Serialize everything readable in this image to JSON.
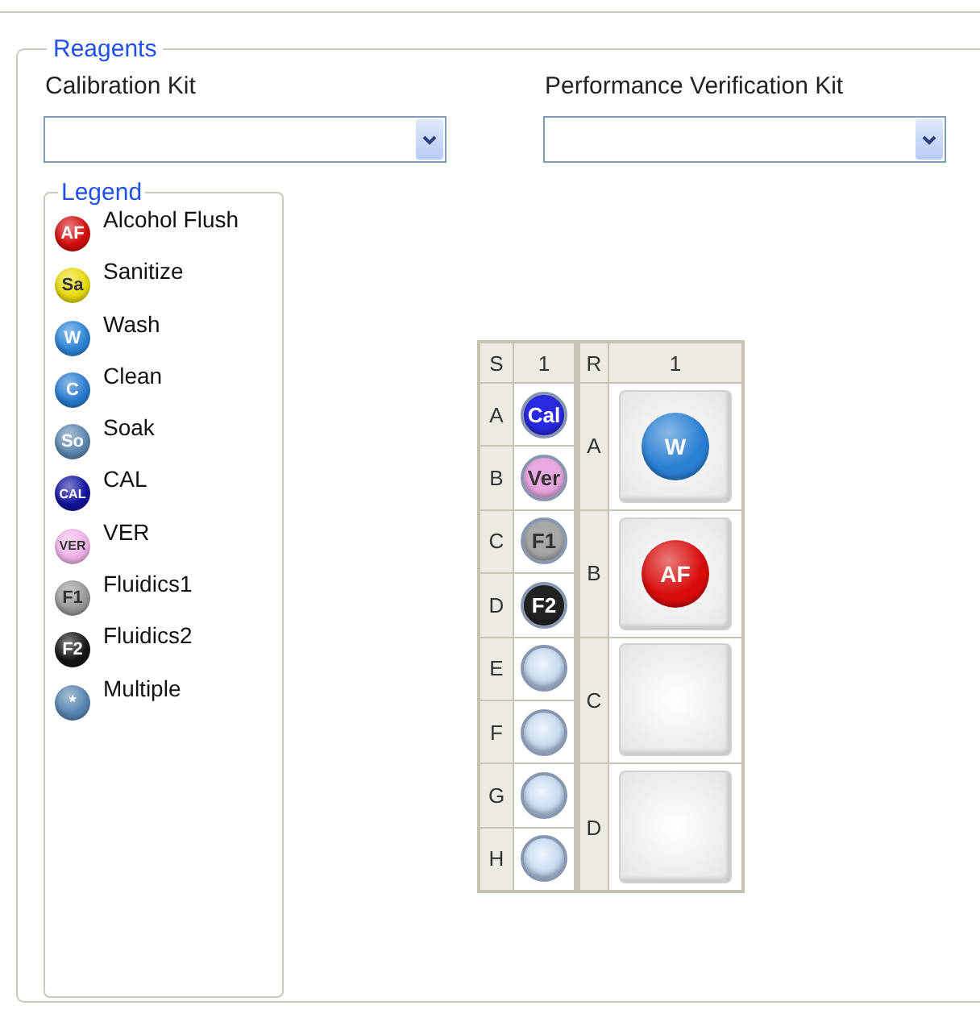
{
  "group_title": "Reagents",
  "kits": [
    {
      "label": "Calibration Kit"
    },
    {
      "label": "Performance Verification Kit"
    }
  ],
  "legend": {
    "title": "Legend",
    "items": [
      {
        "badge": "AF",
        "label": "Alcohol Flush",
        "color": "#d40f0f"
      },
      {
        "badge": "Sa",
        "label": "Sanitize",
        "color": "#e8dc10"
      },
      {
        "badge": "W",
        "label": "Wash",
        "color": "#2e86d8"
      },
      {
        "badge": "C",
        "label": "Clean",
        "color": "#2a7cd0"
      },
      {
        "badge": "So",
        "label": "Soak",
        "color": "#5f88b0"
      },
      {
        "badge": "CAL",
        "label": "CAL",
        "color": "#1414a0"
      },
      {
        "badge": "VER",
        "label": "VER",
        "color": "#f2b4ea"
      },
      {
        "badge": "F1",
        "label": "Fluidics1",
        "color": "#9a9a9a"
      },
      {
        "badge": "F2",
        "label": "Fluidics2",
        "color": "#151515"
      },
      {
        "badge": "*",
        "label": "Multiple",
        "color": "#5a86b2"
      }
    ]
  },
  "plate": {
    "sample_header": {
      "row_label": "S",
      "column": "1"
    },
    "reagent_header": {
      "row_label": "R",
      "column": "1"
    },
    "sample_rows": [
      {
        "row": "A",
        "badge": "Cal",
        "color": "#2a2ae0"
      },
      {
        "row": "B",
        "badge": "Ver",
        "color": "#e8a8e0"
      },
      {
        "row": "C",
        "badge": "F1",
        "color": "#a8a8a8"
      },
      {
        "row": "D",
        "badge": "F2",
        "color": "#222222"
      },
      {
        "row": "E"
      },
      {
        "row": "F"
      },
      {
        "row": "G"
      },
      {
        "row": "H"
      }
    ],
    "reagent_rows": [
      {
        "row": "A",
        "badge": "W",
        "color": "#2a7fd2"
      },
      {
        "row": "B",
        "badge": "AF",
        "color": "#d80c0c"
      },
      {
        "row": "C"
      },
      {
        "row": "D"
      }
    ]
  }
}
